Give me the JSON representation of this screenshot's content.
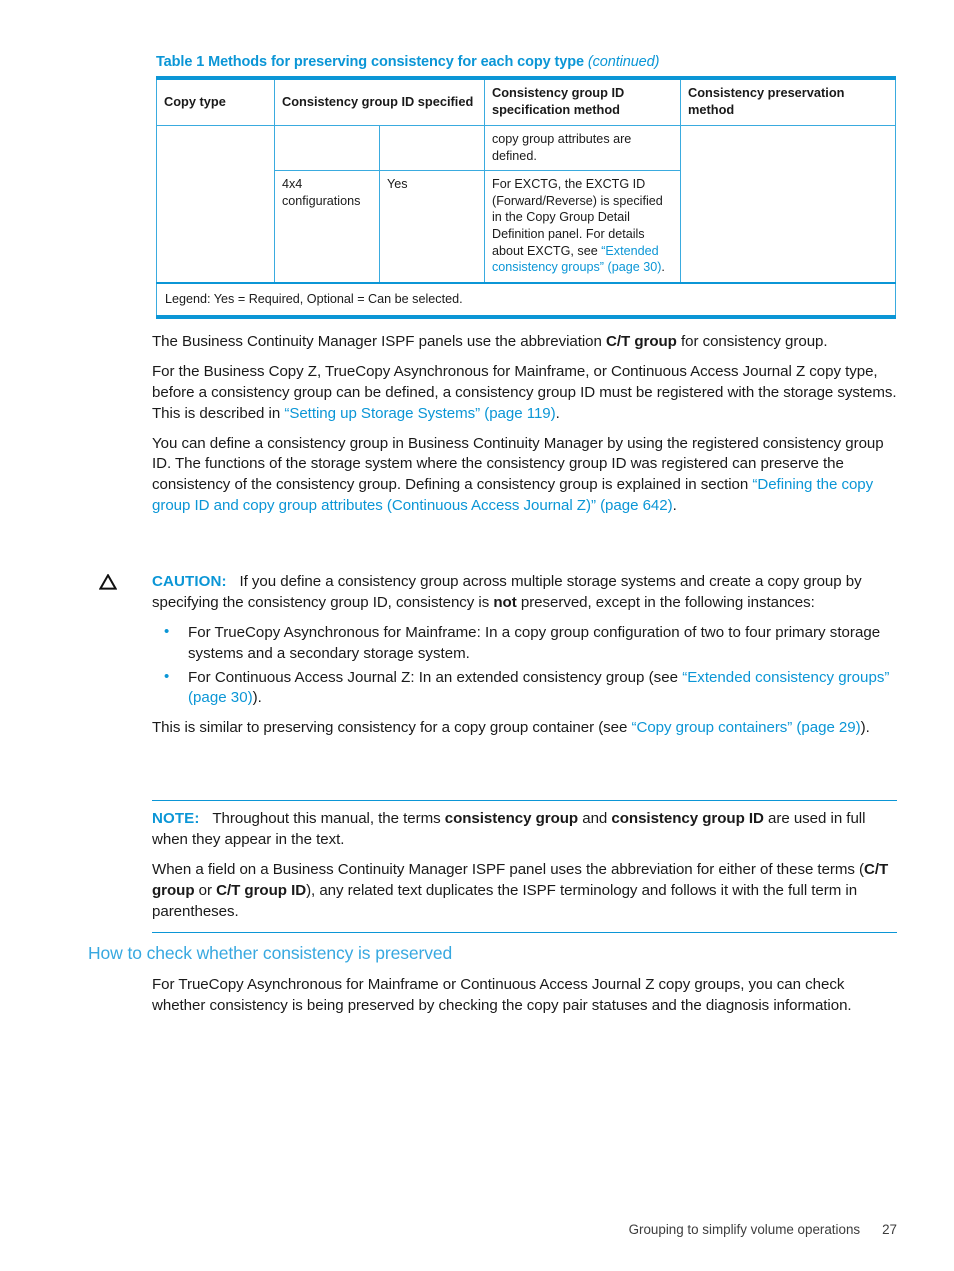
{
  "table": {
    "caption_main": "Table 1 Methods for preserving consistency for each copy type",
    "caption_cont": "(continued)",
    "headers": [
      "Copy type",
      "Consistency group ID specified",
      "Consistency group ID specification method",
      "Consistency preservation method"
    ],
    "rows": [
      {
        "copy_type": "",
        "cg_specified_a": "",
        "cg_specified_b": "",
        "spec_method": "copy group attributes are defined.",
        "preservation": ""
      },
      {
        "copy_type": "",
        "cg_specified_a": "4x4 configurations",
        "cg_specified_b": "Yes",
        "spec_method_pre": "For EXCTG, the EXCTG ID (Forward/Reverse) is specified in the Copy Group Detail Definition panel. For details about EXCTG, see ",
        "spec_method_link": "“Extended consistency groups” (page 30)",
        "spec_method_post": ".",
        "preservation": ""
      }
    ],
    "legend": "Legend: Yes = Required, Optional = Can be selected."
  },
  "body": {
    "p1_a": "The Business Continuity Manager ISPF panels use the abbreviation ",
    "p1_b": "C/T group",
    "p1_c": " for consistency group.",
    "p2_a": "For the Business Copy Z, TrueCopy Asynchronous for Mainframe, or Continuous Access Journal Z copy type, before a consistency group can be defined, a consistency group ID must be registered with the storage systems. This is described in ",
    "p2_link": "“Setting up Storage Systems” (page 119)",
    "p2_c": ".",
    "p3_a": "You can define a consistency group in Business Continuity Manager by using the registered consistency group ID. The functions of the storage system where the consistency group ID was registered can preserve the consistency of the consistency group. Defining a consistency group is explained in section ",
    "p3_link": "“Defining the copy group ID and copy group attributes (Continuous Access Journal Z)” (page 642)",
    "p3_c": "."
  },
  "caution": {
    "icon": "warning-triangle-icon",
    "label": "CAUTION:",
    "text_a": "If you define a consistency group across multiple storage systems and create a copy group by specifying the consistency group ID, consistency is ",
    "text_bold": "not",
    "text_b": " preserved, except in the following instances:",
    "bullets": [
      {
        "text_a": "For TrueCopy Asynchronous for Mainframe: In a copy group configuration of two to four primary storage systems and a secondary storage system.",
        "link": "",
        "text_b": ""
      },
      {
        "text_a": "For Continuous Access Journal Z: In an extended consistency group (see ",
        "link": "“Extended consistency groups” (page 30)",
        "text_b": ")."
      }
    ],
    "closing_a": "This is similar to preserving consistency for a copy group container (see ",
    "closing_link": "“Copy group containers” (page 29)",
    "closing_b": ")."
  },
  "note": {
    "label": "NOTE:",
    "p1_a": "Throughout this manual, the terms ",
    "p1_b1": "consistency group",
    "p1_c": " and ",
    "p1_b2": "consistency group ID",
    "p1_d": " are used in full when they appear in the text.",
    "p2_a": "When a field on a Business Continuity Manager ISPF panel uses the abbreviation for either of these terms (",
    "p2_b1": "C/T group",
    "p2_c": " or ",
    "p2_b2": "C/T group ID",
    "p2_d": "), any related text duplicates the ISPF terminology and follows it with the full term in parentheses."
  },
  "section": {
    "heading": "How to check whether consistency is preserved",
    "paragraph": "For TrueCopy Asynchronous for Mainframe or Continuous Access Journal Z copy groups, you can check whether consistency is being preserved by checking the copy pair statuses and the diagnosis information."
  },
  "footer": {
    "running_title": "Grouping to simplify volume operations",
    "page_number": "27"
  },
  "colors": {
    "accent_blue": "#0b96d6",
    "link_blue": "#2aa3dc",
    "heading_blue": "#37a8e0",
    "table_rule": "#3aabdf",
    "text": "#1a1a1a"
  }
}
